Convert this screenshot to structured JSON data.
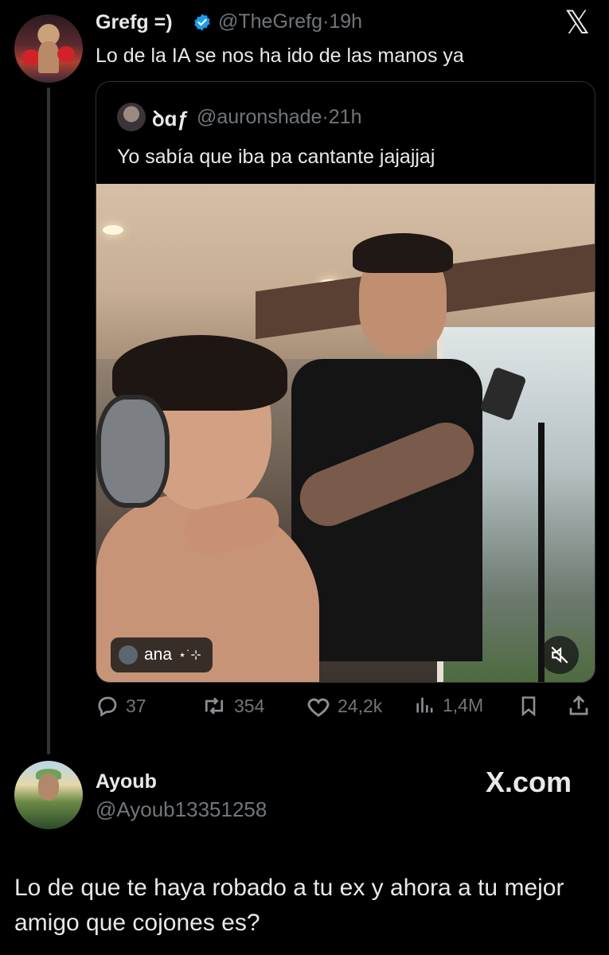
{
  "tweet": {
    "author_name": "Grefg =)",
    "handle": "@TheGrefg",
    "separator": "·",
    "time": "19h",
    "text": "Lo de la IA se nos ha ido de las manos ya",
    "verified": true,
    "close_icon": "x-logo-icon"
  },
  "quoted_tweet": {
    "author_name": "ꝺɑƒ",
    "handle": "@auronshade",
    "separator": "·",
    "time": "21h",
    "text": "Yo sabía que iba pa cantante jajajjaj",
    "media": {
      "tag_label": "ana",
      "tag_sparkle": "⋆˙⊹",
      "mute_icon": "volume-muted-icon"
    }
  },
  "actions": {
    "replies": "37",
    "reposts": "354",
    "likes": "24,2k",
    "views": "1,4M"
  },
  "reply": {
    "author_name": "Ayoub",
    "handle": "@Ayoub13351258",
    "site_label": "X.com",
    "text": "Lo de que te haya robado a tu ex y ahora a tu mejor amigo que cojones es?"
  },
  "colors": {
    "background": "#000000",
    "text": "#e7e9ea",
    "muted": "#71767b",
    "verified": "#1d9bf0",
    "border": "#2f3336"
  }
}
